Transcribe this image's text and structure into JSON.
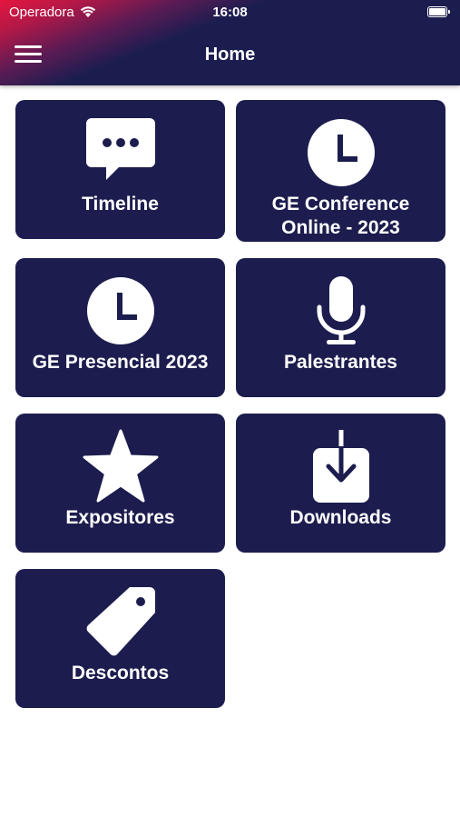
{
  "status_bar": {
    "carrier": "Operadora",
    "time": "16:08"
  },
  "header": {
    "title": "Home"
  },
  "tiles": [
    {
      "label": "Timeline",
      "icon": "chat-bubble-icon"
    },
    {
      "label": "GE Conference Online - 2023",
      "icon": "clock-icon"
    },
    {
      "label": "GE Presencial 2023",
      "icon": "clock-icon"
    },
    {
      "label": "Palestrantes",
      "icon": "microphone-icon"
    },
    {
      "label": "Expositores",
      "icon": "star-icon"
    },
    {
      "label": "Downloads",
      "icon": "download-icon"
    },
    {
      "label": "Descontos",
      "icon": "tag-icon"
    }
  ],
  "colors": {
    "tile_background": "#1c1d4e",
    "header_accent": "#e4163f",
    "header_base": "#1a1d4e"
  }
}
